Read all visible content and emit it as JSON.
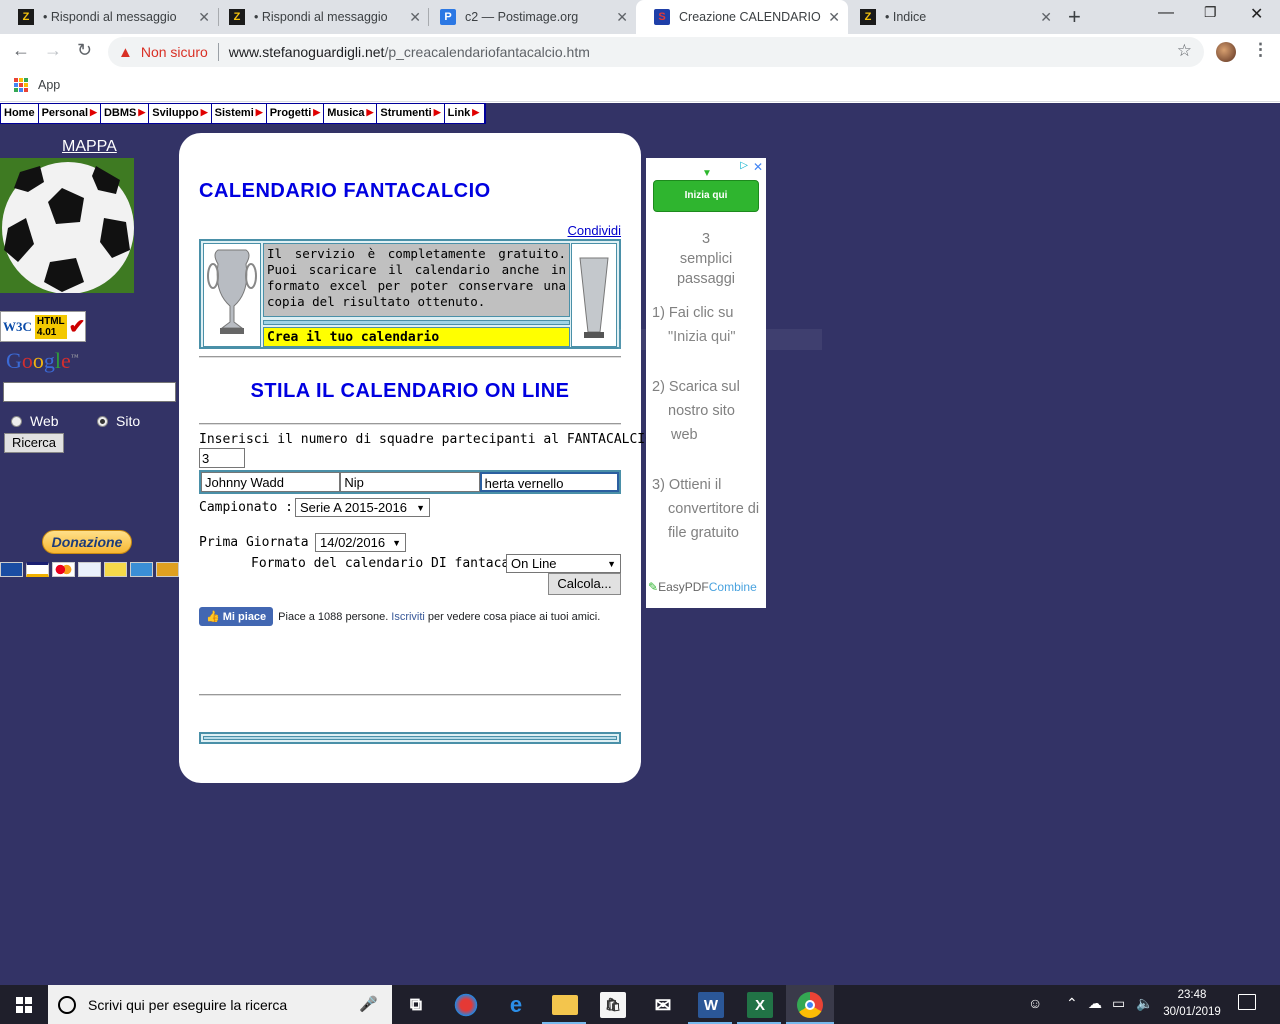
{
  "browser": {
    "tabs": [
      {
        "title": "• Rispondi al messaggio",
        "icon": "z-favicon",
        "active": false
      },
      {
        "title": "• Rispondi al messaggio",
        "icon": "z-favicon",
        "active": false
      },
      {
        "title": "c2 — Postimage.org",
        "icon": "postimage-favicon",
        "active": false
      },
      {
        "title": "Creazione CALENDARIO pe",
        "icon": "superman-favicon",
        "active": true
      },
      {
        "title": "• Indice",
        "icon": "z-favicon",
        "active": false
      }
    ],
    "not_secure_label": "Non sicuro",
    "url_host": "www.stefanoguardigli.net",
    "url_path": "/p_creacalendariofantacalcio.htm",
    "bookmarks": {
      "apps_label": "App"
    }
  },
  "site": {
    "menu": [
      {
        "label": "Home",
        "has_arrow": false
      },
      {
        "label": "Personal",
        "has_arrow": true
      },
      {
        "label": "DBMS",
        "has_arrow": true
      },
      {
        "label": "Sviluppo",
        "has_arrow": true
      },
      {
        "label": "Sistemi",
        "has_arrow": true
      },
      {
        "label": "Progetti",
        "has_arrow": true
      },
      {
        "label": "Musica",
        "has_arrow": true
      },
      {
        "label": "Strumenti",
        "has_arrow": true
      },
      {
        "label": "Link",
        "has_arrow": true
      }
    ],
    "sidebar": {
      "mappa": "MAPPA",
      "w3c_left": "W3C",
      "w3c_html": "HTML",
      "w3c_version": "4.01",
      "google_letters": [
        {
          "ch": "G",
          "color": "#3b6ad6"
        },
        {
          "ch": "o",
          "color": "#d22e2e"
        },
        {
          "ch": "o",
          "color": "#f2b50f"
        },
        {
          "ch": "g",
          "color": "#3b6ad6"
        },
        {
          "ch": "l",
          "color": "#2f9d3a"
        },
        {
          "ch": "e",
          "color": "#d22e2e"
        }
      ],
      "google_tm": "™",
      "radio_web": "Web",
      "radio_sito": "Sito",
      "search_button": "Ricerca",
      "donate_button": "Donazione"
    },
    "main": {
      "title": "CALENDARIO FANTACALCIO",
      "share_link": "Condividi",
      "info_text": "Il servizio è completamente gratuito. Puoi scaricare il calendario anche in formato excel per poter conservare una copia del risultato ottenuto.",
      "create_label": "Crea il tuo calendario",
      "subtitle": "STILA IL CALENDARIO ON LINE",
      "teams_label": "Inserisci il numero di squadre partecipanti al FANTACALCIO :",
      "teams_count": "3",
      "team_names": [
        "Johnny Wadd",
        "Nip",
        "herta vernello"
      ],
      "championship_label": "Campionato :",
      "championship_value": "Serie A 2015-2016",
      "first_day_label": "Prima Giornata :",
      "first_day_value": "14/02/2016",
      "format_label": "Formato del calendario DI fantacalcio",
      "format_value": "On Line",
      "calc_button": "Calcola...",
      "fb_button": "Mi piace",
      "fb_text_1": "Piace a 1088 persone.",
      "fb_link": "Iscriviti",
      "fb_text_2": "per vedere cosa piace ai tuoi amici."
    },
    "ad": {
      "button": "Inizia qui",
      "line1": "3",
      "line2": "semplici",
      "line3": "passaggi",
      "step1a": "1) Fai clic su",
      "step1b": "\"Inizia qui\"",
      "step2a": "2) Scarica sul",
      "step2b": "nostro sito",
      "step2c": "web",
      "step3a": "3) Ottieni il",
      "step3b": "convertitore di",
      "step3c": "file gratuito",
      "brand_a": "EasyPDF",
      "brand_b": "Combine"
    }
  },
  "taskbar": {
    "search_placeholder": "Scrivi qui per eseguire la ricerca",
    "time": "23:48",
    "date": "30/01/2019"
  }
}
